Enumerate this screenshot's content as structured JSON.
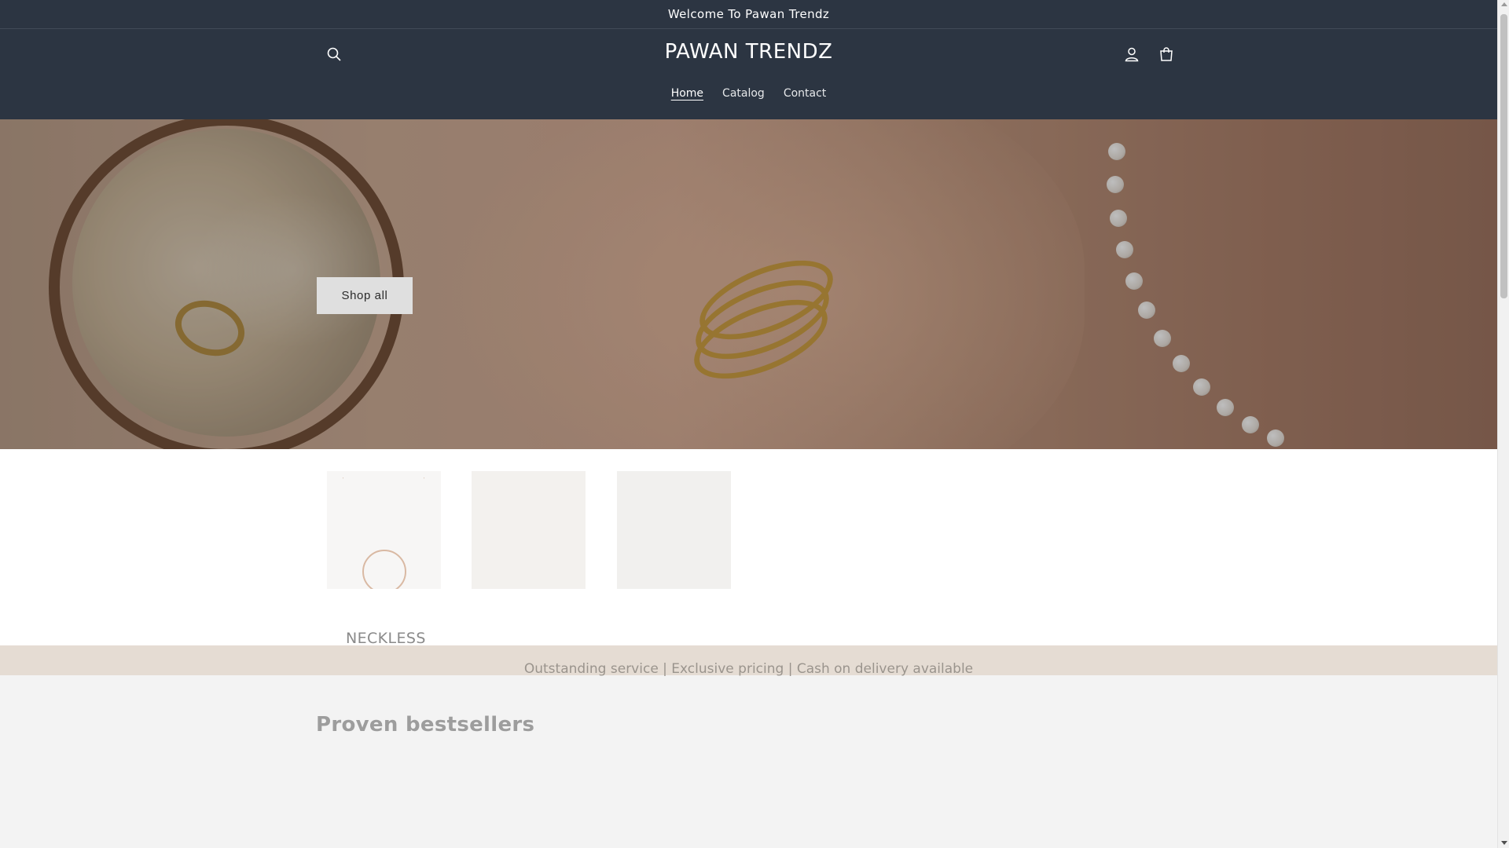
{
  "announcement": {
    "text": "Welcome To Pawan Trendz"
  },
  "header": {
    "logo": "PAWAN TRENDZ",
    "nav": [
      {
        "label": "Home",
        "active": true
      },
      {
        "label": "Catalog",
        "active": false
      },
      {
        "label": "Contact",
        "active": false
      }
    ],
    "icons": {
      "search": "search-icon",
      "account": "user-icon",
      "cart": "cart-icon"
    }
  },
  "hero": {
    "button_label": "Shop all"
  },
  "collections": [
    {
      "label": "NECKLESS"
    }
  ],
  "strip": {
    "text": "Outstanding service | Exclusive pricing | Cash on delivery available"
  },
  "bestsellers": {
    "title": "Proven bestsellers"
  },
  "colors": {
    "header_bg": "#2c3542",
    "strip_bg": "#e5dcd3",
    "page_bg": "#f3f3f3"
  }
}
